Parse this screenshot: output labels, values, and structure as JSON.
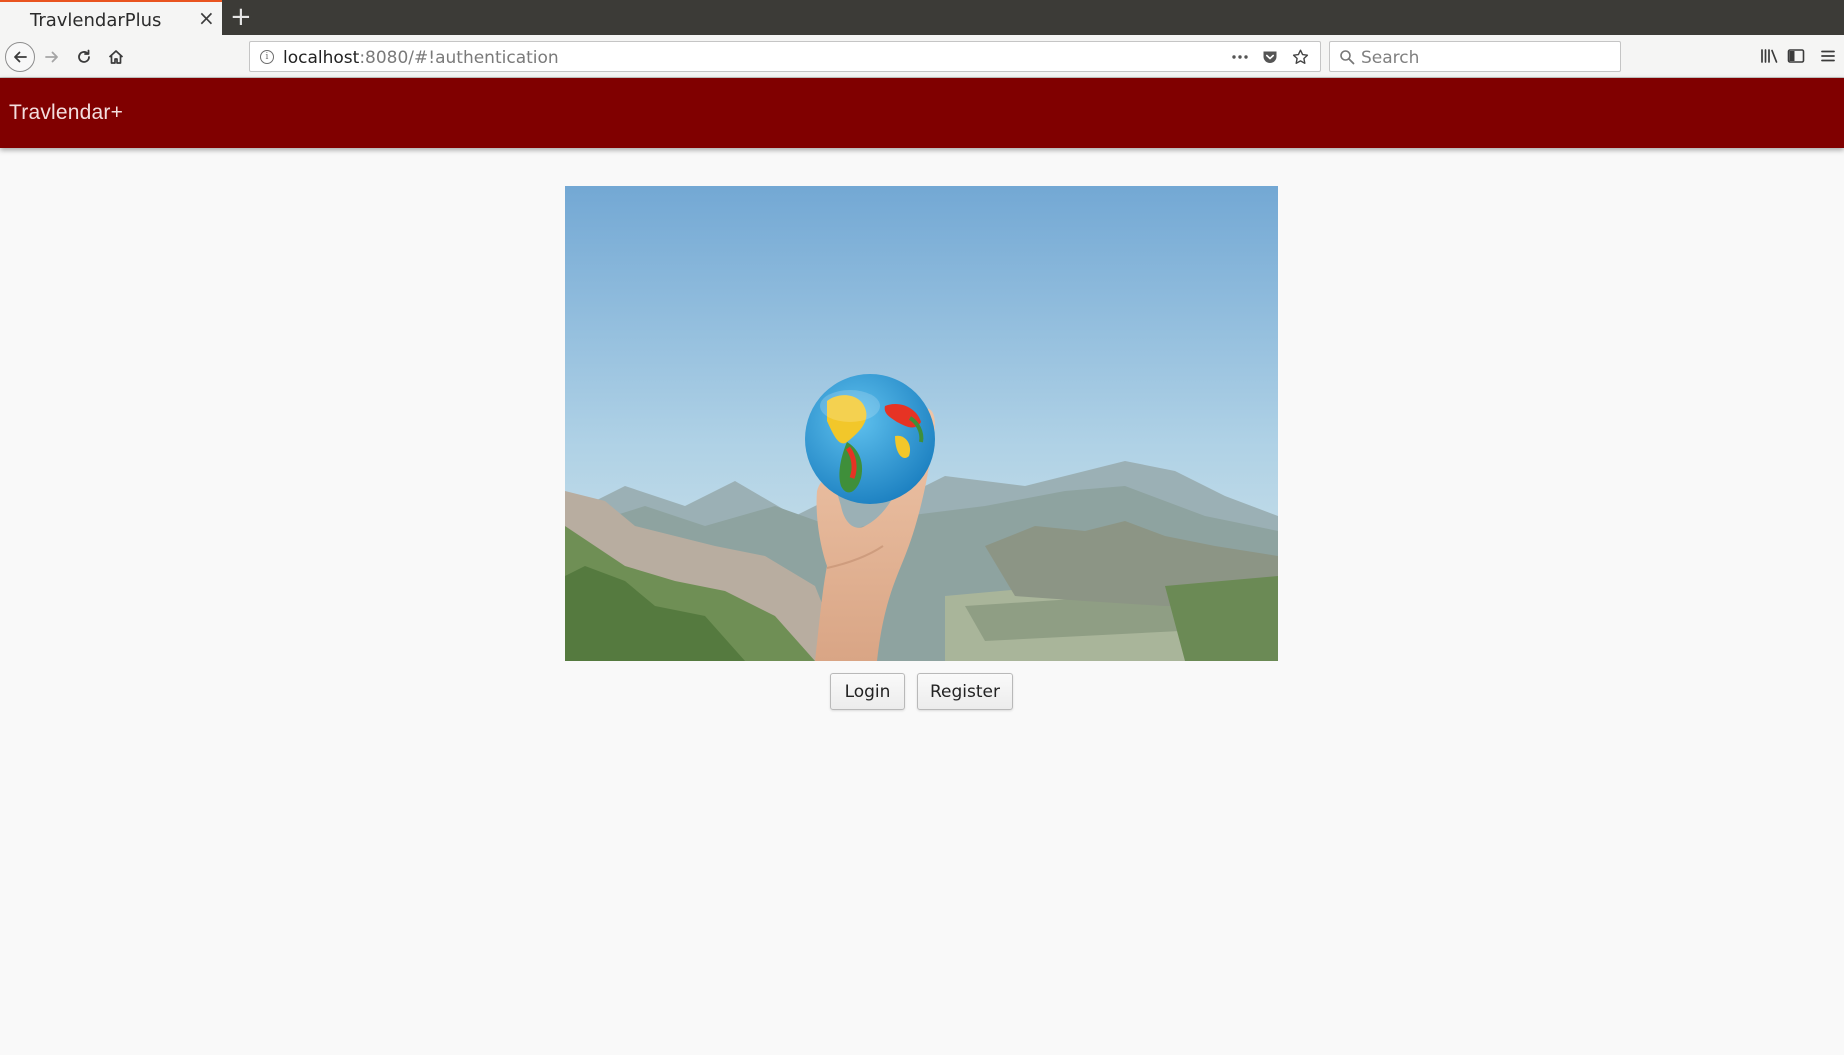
{
  "browser": {
    "tab": {
      "title": "TravlendarPlus",
      "close_glyph": "×",
      "accent": "#e95420"
    },
    "new_tab_glyph": "+",
    "address": {
      "host": "localhost",
      "rest": ":8080/#!authentication"
    },
    "search": {
      "placeholder": "Search"
    },
    "icons": [
      "back-arrow-icon",
      "forward-arrow-icon",
      "reload-icon",
      "home-icon",
      "info-icon",
      "page-actions-icon",
      "pocket-icon",
      "bookmark-star-icon",
      "search-icon",
      "library-icon",
      "sidebar-icon",
      "menu-icon"
    ]
  },
  "app": {
    "title": "Travlendar+",
    "header_color": "#800000"
  },
  "hero": {
    "icon": "globe-in-hand-image"
  },
  "actions": {
    "login_label": "Login",
    "register_label": "Register"
  }
}
